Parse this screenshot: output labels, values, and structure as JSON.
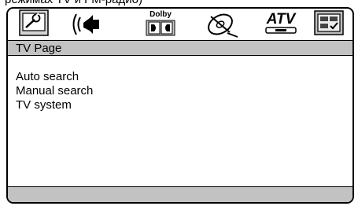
{
  "caption_cropped": "режимах TV и FM-радио)",
  "tabs": [
    {
      "name": "system-setup-icon"
    },
    {
      "name": "audio-speaker-icon"
    },
    {
      "name": "dolby-digital-icon",
      "label": "Dolby"
    },
    {
      "name": "disc-icon"
    },
    {
      "name": "atv-icon",
      "label": "ATV"
    },
    {
      "name": "preference-icon"
    }
  ],
  "page": {
    "title": "TV Page"
  },
  "menu": {
    "items": [
      "Auto search",
      "Manual search",
      "TV system"
    ]
  }
}
